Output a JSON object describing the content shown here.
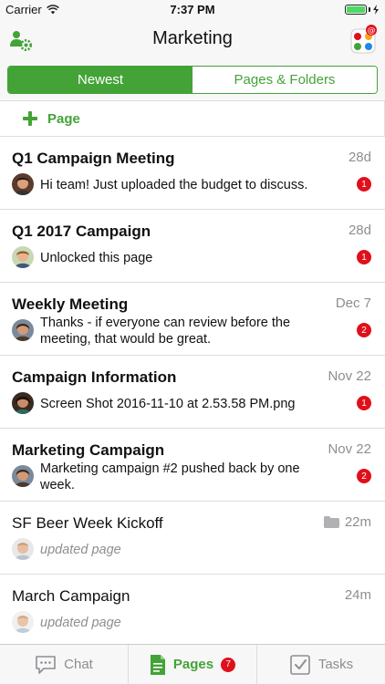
{
  "status_bar": {
    "carrier": "Carrier",
    "time": "7:37 PM"
  },
  "nav": {
    "title": "Marketing",
    "left_icon": "group-settings-icon",
    "right_icon": "app-switcher-mentions-icon"
  },
  "segment": {
    "tabs": [
      "Newest",
      "Pages & Folders"
    ],
    "selected": "Newest"
  },
  "add_row": {
    "label": "Page"
  },
  "items": [
    {
      "title": "Q1 Campaign Meeting",
      "time": "28d",
      "message": "Hi team! Just uploaded the budget to discuss.",
      "badge": "1",
      "bold": true
    },
    {
      "title": "Q1 2017 Campaign",
      "time": "28d",
      "message": "Unlocked this page",
      "badge": "1",
      "bold": true
    },
    {
      "title": "Weekly Meeting",
      "time": "Dec 7",
      "message": "Thanks - if everyone can review before the meeting, that would be great.",
      "badge": "2",
      "bold": true
    },
    {
      "title": "Campaign Information",
      "time": "Nov 22",
      "message": "Screen Shot 2016-11-10 at 2.53.58 PM.png",
      "badge": "1",
      "bold": true
    },
    {
      "title": "Marketing Campaign",
      "time": "Nov 22",
      "message": "Marketing campaign #2 pushed back by one week.",
      "badge": "2",
      "bold": true
    },
    {
      "title": "SF Beer Week Kickoff",
      "time": "22m",
      "message": "updated page",
      "badge": "",
      "bold": false,
      "folder": true
    },
    {
      "title": "March Campaign",
      "time": "24m",
      "message": "updated page",
      "badge": "",
      "bold": false
    }
  ],
  "tab_bar": {
    "tabs": [
      {
        "label": "Chat",
        "icon": "chat-icon"
      },
      {
        "label": "Pages",
        "icon": "pages-icon",
        "badge": "7"
      },
      {
        "label": "Tasks",
        "icon": "tasks-icon"
      }
    ],
    "selected": "Pages"
  },
  "colors": {
    "accent": "#43a337",
    "badge": "#e0101a",
    "secondary_text": "#8e8e93"
  }
}
